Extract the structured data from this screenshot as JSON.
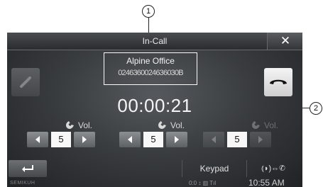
{
  "annotations": {
    "callout_1": "1",
    "callout_2": "2"
  },
  "header": {
    "title": "In-Call",
    "close_icon": "close-icon"
  },
  "caller": {
    "name": "Alpine Office",
    "number": "0246360024636030B"
  },
  "call": {
    "elapsed_time": "00:00:21"
  },
  "controls": {
    "mic_icon": "microphone-mute-icon",
    "hangup_icon": "hang-up-icon",
    "volumes": [
      {
        "label": "Vol.",
        "icon": "phone-volume-icon",
        "value": "5",
        "enabled": true
      },
      {
        "label": "Vol.",
        "icon": "handset-volume-icon",
        "value": "5",
        "enabled": true
      },
      {
        "label": "Vol.",
        "icon": "ringer-volume-icon",
        "value": "5",
        "enabled": false
      }
    ]
  },
  "footer": {
    "back_icon": "return-arrow-icon",
    "keypad_label": "Keypad",
    "transfer_label": "⦅◗)⇔✆",
    "brand": "SEMIKUH",
    "status_icons": "0:0 ↕ ▥ Tıl",
    "clock": "10:55 AM"
  },
  "colors": {
    "screen_bg": "#3a3d40",
    "text": "#f4f4f4",
    "hangup_bg": "#e6e6e6"
  }
}
